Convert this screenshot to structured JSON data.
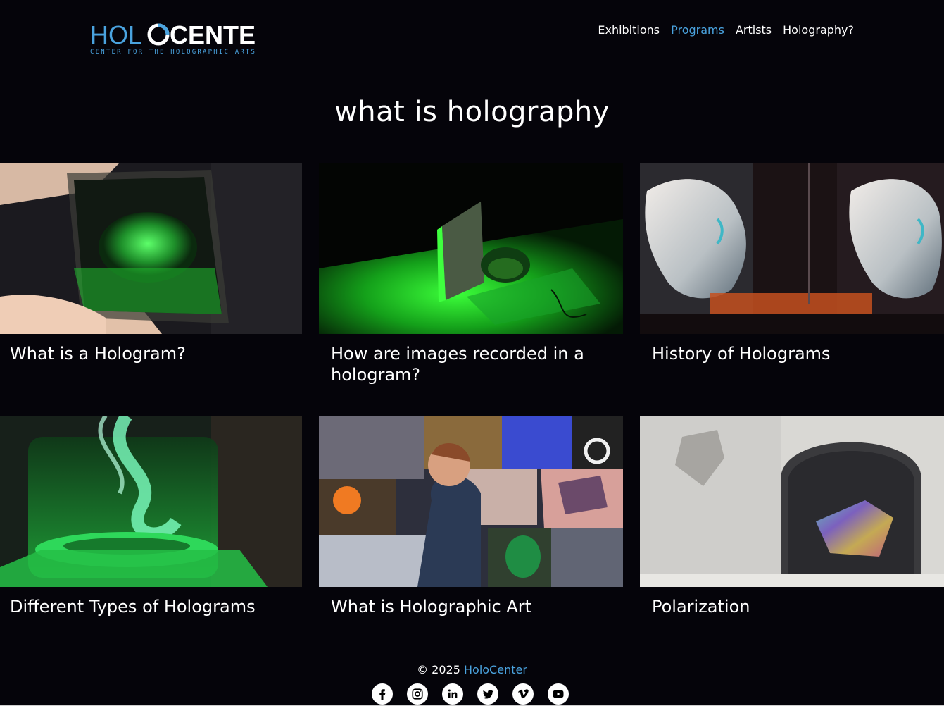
{
  "brand": {
    "logo_text_left": "HOL",
    "logo_text_right": "CENTER",
    "logo_tagline": "CENTER FOR THE HOLOGRAPHIC ARTS",
    "logo_icon": "holocenter-logo",
    "accent_color": "#4aa3df"
  },
  "nav": {
    "items": [
      {
        "label": "Exhibitions",
        "active": false
      },
      {
        "label": "Programs",
        "active": true
      },
      {
        "label": "Artists",
        "active": false
      },
      {
        "label": "Holography?",
        "active": false
      }
    ]
  },
  "page": {
    "title": "what is holography"
  },
  "cards": [
    {
      "title": "What is a Hologram?",
      "image": "hand-holding-green-hologram-cube"
    },
    {
      "title": "How are images recorded in a hologram?",
      "image": "green-laser-lit-plant-and-plate"
    },
    {
      "title": "History of Holograms",
      "image": "classical-bust-holograms"
    },
    {
      "title": "Different Types of Holograms",
      "image": "green-swirl-hologram-on-pedestal"
    },
    {
      "title": "What is Holographic Art",
      "image": "speaker-in-front-of-projection-collage"
    },
    {
      "title": "Polarization",
      "image": "iridescent-sculpture-in-white-alcove"
    }
  ],
  "footer": {
    "copyright": "© 2025",
    "brand_link": "HoloCenter",
    "socials": [
      "facebook-icon",
      "instagram-icon",
      "linkedin-icon",
      "twitter-icon",
      "vimeo-icon",
      "youtube-icon"
    ]
  }
}
